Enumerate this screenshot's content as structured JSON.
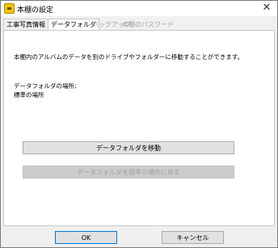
{
  "window": {
    "title": "本棚の設定",
    "close_symbol": "✕"
  },
  "tabs": [
    {
      "label": "工事写真情報",
      "state": "normal"
    },
    {
      "label": "データフォルダ",
      "state": "active"
    },
    {
      "label": "バックアップ",
      "state": "disabled"
    },
    {
      "label": "本棚のパスワード",
      "state": "disabled"
    }
  ],
  "panel": {
    "description": "本棚内のアルバムのデータを別のドライブやフォルダーに移動することができます。",
    "location_label": "データフォルダの場所：",
    "location_value": "標準の場所",
    "move_button": "データフォルダを移動",
    "reset_button": "データフォルダを標準の場所に戻す"
  },
  "footer": {
    "ok_label": "OK",
    "cancel_label": "キャンセル"
  }
}
